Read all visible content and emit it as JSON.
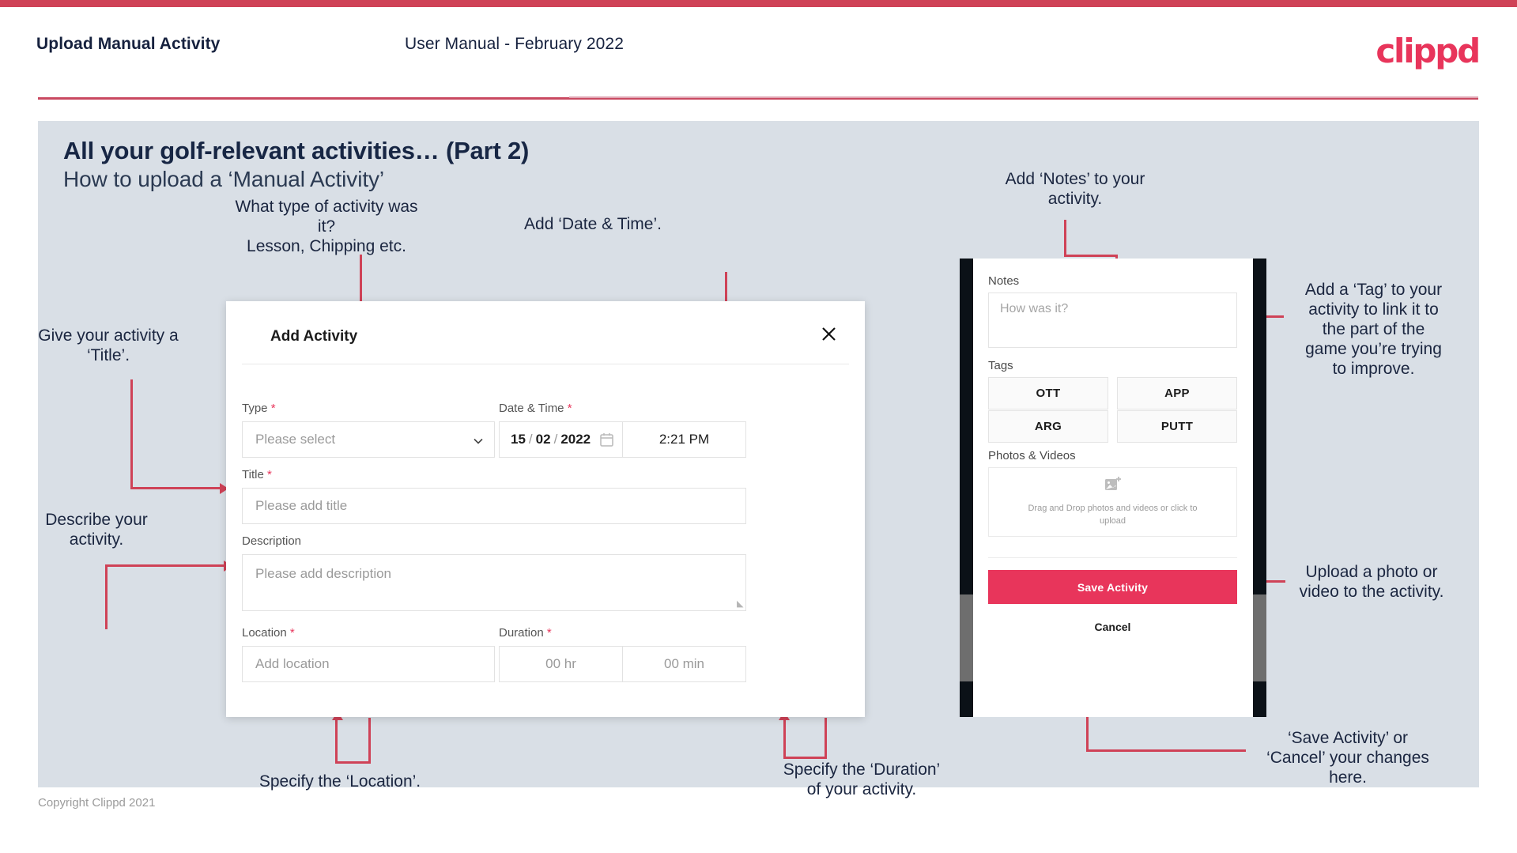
{
  "header": {
    "title": "Upload Manual Activity",
    "subtitle": "User Manual - February 2022",
    "logo": "clippd"
  },
  "slide": {
    "title": "All your golf-relevant activities… (Part 2)",
    "subtitle": "How to upload a ‘Manual Activity’"
  },
  "annotations": {
    "type": "What type of activity was it?\nLesson, Chipping etc.",
    "datetime": "Add ‘Date & Time’.",
    "title": "Give your activity a\n‘Title’.",
    "description": "Describe your\nactivity.",
    "location": "Specify the ‘Location’.",
    "duration": "Specify the ‘Duration’\nof your activity.",
    "notes": "Add ‘Notes’ to your\nactivity.",
    "tags": "Add a ‘Tag’ to your\nactivity to link it to\nthe part of the\ngame you’re trying\nto improve.",
    "photos": "Upload a photo or\nvideo to the activity.",
    "save": "‘Save Activity’ or\n‘Cancel’ your changes\nhere."
  },
  "dialog": {
    "title": "Add Activity",
    "close_label": "✕",
    "fields": {
      "type": {
        "label": "Type",
        "required": true,
        "placeholder": "Please select"
      },
      "datetime": {
        "label": "Date & Time",
        "required": true,
        "day": "15",
        "sep1": "/",
        "month": "02",
        "sep2": "/",
        "year": "2022",
        "time": "2:21 PM"
      },
      "title": {
        "label": "Title",
        "required": true,
        "placeholder": "Please add title"
      },
      "description": {
        "label": "Description",
        "required": false,
        "placeholder": "Please add description"
      },
      "location": {
        "label": "Location",
        "required": true,
        "placeholder": "Add location"
      },
      "duration": {
        "label": "Duration",
        "required": true,
        "hours": "00 hr",
        "minutes": "00 min"
      }
    }
  },
  "phone": {
    "notes": {
      "label": "Notes",
      "placeholder": "How was it?"
    },
    "tags": {
      "label": "Tags",
      "items": [
        "OTT",
        "APP",
        "ARG",
        "PUTT"
      ]
    },
    "photos": {
      "label": "Photos & Videos",
      "drop_text": "Drag and Drop photos and videos or click to upload"
    },
    "save_label": "Save Activity",
    "cancel_label": "Cancel"
  },
  "footer": "Copyright Clippd 2021",
  "colors": {
    "accent": "#e8355b",
    "line": "#cf4257",
    "slide_bg": "#d9dfe6",
    "text_dark": "#1b2640"
  }
}
